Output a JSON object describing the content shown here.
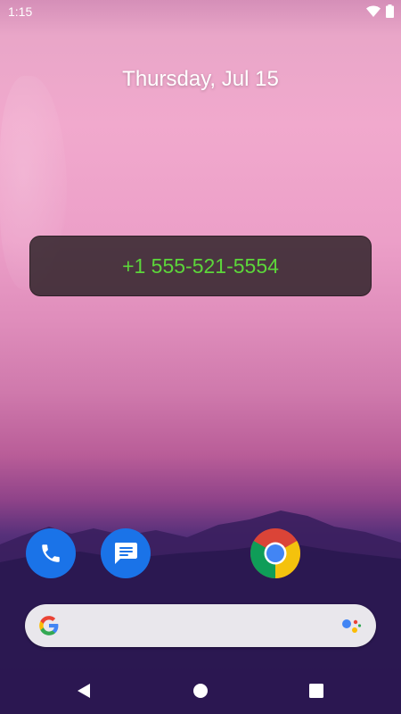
{
  "status_bar": {
    "time": "1:15",
    "icons": [
      "wifi-icon",
      "battery-icon"
    ]
  },
  "home": {
    "date": "Thursday, Jul 15",
    "widget_number": "+1 555-521-5554",
    "widget_number_color": "#5cd63a"
  },
  "dock": {
    "apps": [
      "phone-icon",
      "messages-icon",
      "chrome-icon"
    ]
  },
  "search": {
    "icons": [
      "google-g-icon",
      "google-assistant-icon"
    ]
  },
  "nav": {
    "buttons": [
      "back-icon",
      "home-icon",
      "recents-icon"
    ]
  }
}
